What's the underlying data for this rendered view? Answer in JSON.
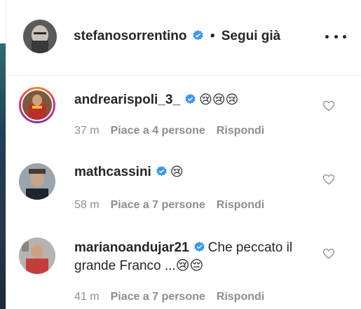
{
  "post_header": {
    "username": "stefanosorrentino",
    "separator": "•",
    "follow_status": "Segui già"
  },
  "comments": [
    {
      "username": "andrearispoli_3_",
      "text": "😢😢😢",
      "time": "37 m",
      "likes": "Piace a 4 persone",
      "reply": "Rispondi",
      "has_story": true
    },
    {
      "username": "mathcassini",
      "text": "😢",
      "time": "58 m",
      "likes": "Piace a 7 persone",
      "reply": "Rispondi",
      "has_story": false
    },
    {
      "username": "marianoandujar21",
      "text": "Che peccato il grande Franco ...😢😔",
      "time": "41 m",
      "likes": "Piace a 7 persone",
      "reply": "Rispondi",
      "has_story": false
    }
  ],
  "colors": {
    "verified_blue": "#3897f0",
    "meta_gray": "#8e8e8e",
    "text_dark": "#262626"
  },
  "icons": [
    "verified-badge-icon",
    "more-options-icon",
    "heart-icon"
  ]
}
